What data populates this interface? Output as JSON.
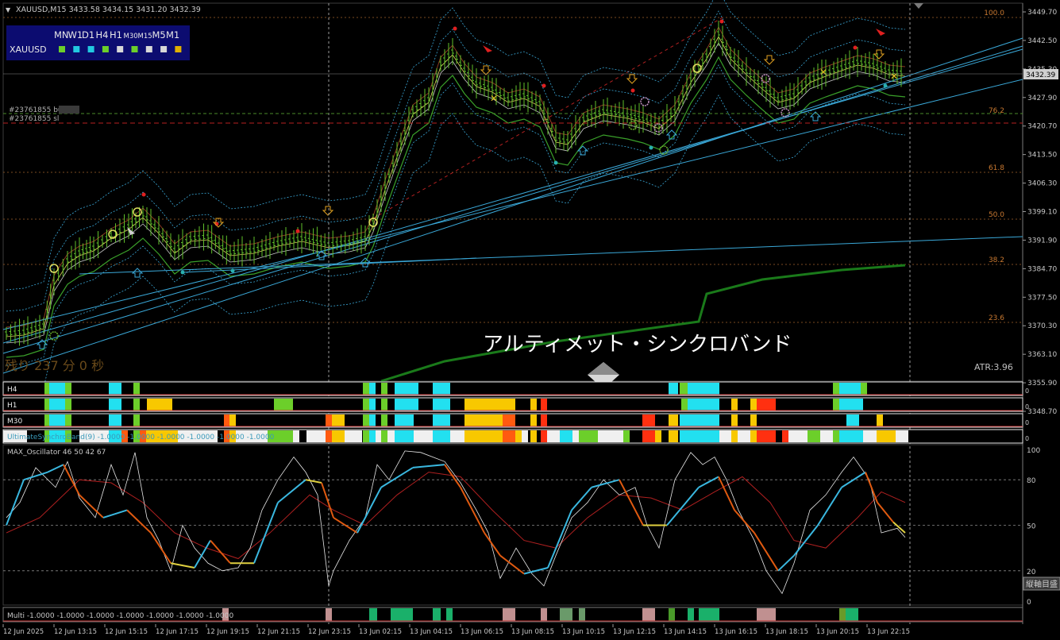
{
  "window": {
    "symbol_header": "XAUUSD,M15  3433.58 3434.15 3431.20 3432.39",
    "current_price": "3432.39",
    "atr": "ATR:3.96",
    "countdown": "残り 237 分 0 秒",
    "annotation": "アルティメット・シンクロバンド",
    "order_buy": "#23761855 bu",
    "order_sl": "#23761855 sl",
    "vertical_axis_button": "縦軸目盛"
  },
  "mtf_panel": {
    "symbol": "XAUUSD",
    "timeframes": [
      "MN",
      "W1",
      "D1",
      "H4",
      "H1",
      "M30",
      "M15",
      "M5",
      "M1"
    ],
    "square_colors": [
      "#6ccf2a",
      "#22c9e0",
      "#22c9e0",
      "#6ccf2a",
      "#d8d8d8",
      "#6ccf2a",
      "#d8d8d8",
      "#d8d8d8",
      "#e0b000"
    ]
  },
  "price_axis": {
    "labels": [
      "3449.70",
      "3442.50",
      "3435.30",
      "3427.90",
      "3420.70",
      "3413.50",
      "3406.30",
      "3399.10",
      "3391.90",
      "3384.70",
      "3377.50",
      "3370.30",
      "3363.10",
      "3355.90",
      "3348.70"
    ]
  },
  "fibo_levels": [
    "100.0",
    "76.2",
    "61.8",
    "50.0",
    "38.2",
    "23.6"
  ],
  "synchro_strips": [
    {
      "label": "H4"
    },
    {
      "label": "H1"
    },
    {
      "label": "M30"
    },
    {
      "label": "UltimateSynchroBand(9) -1.0000 -1.0000 -1.0000 -1.0000 -1.0000 -1.0000"
    }
  ],
  "oscillator": {
    "title": "MAX_Oscillator 46 50 42 67",
    "levels": [
      "100",
      "80",
      "50",
      "20",
      "0"
    ]
  },
  "multi": {
    "title": "Multi -1.0000 -1.0000 -1.0000 -1.0000 -1.0000 -1.0000 -1.0000"
  },
  "time_axis": {
    "labels": [
      "12 Jun 2025",
      "12 Jun 13:15",
      "12 Jun 15:15",
      "12 Jun 17:15",
      "12 Jun 19:15",
      "12 Jun 21:15",
      "12 Jun 23:15",
      "13 Jun 02:15",
      "13 Jun 04:15",
      "13 Jun 06:15",
      "13 Jun 08:15",
      "13 Jun 10:15",
      "13 Jun 12:15",
      "13 Jun 14:15",
      "13 Jun 16:15",
      "13 Jun 18:15",
      "13 Jun 20:15",
      "13 Jun 22:15"
    ]
  },
  "colors": {
    "candle": "#5fbf2a",
    "background": "#000000",
    "grid": "#5a5a5a",
    "fibo": "#c87830",
    "trendline": "#3aa8d8",
    "price_box": "#c8c8c8",
    "accent_bg": "#0c0c70"
  }
}
